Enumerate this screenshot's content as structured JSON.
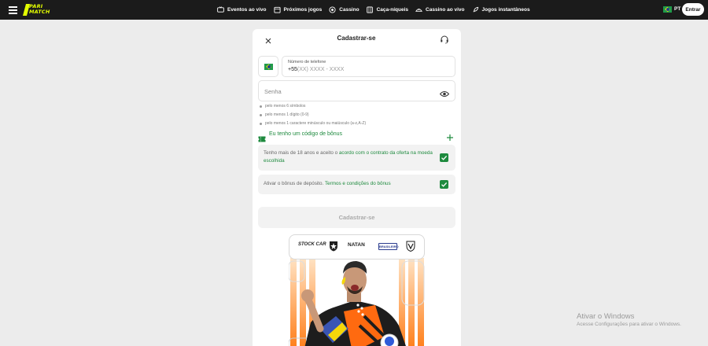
{
  "brand": {
    "logo_line1": "PARI",
    "logo_line2": "MATCH",
    "accent": "#e4ff00"
  },
  "nav": {
    "items": [
      {
        "label": "Eventos ao vivo",
        "icon": "live-tv-icon"
      },
      {
        "label": "Próximos jogos",
        "icon": "calendar-icon"
      },
      {
        "label": "Cassino",
        "icon": "casino-chip-icon"
      },
      {
        "label": "Caça-níqueis",
        "icon": "slot-machine-icon"
      },
      {
        "label": "Cassino ao vivo",
        "icon": "live-casino-icon"
      },
      {
        "label": "Jogos instantâneos",
        "icon": "rocket-icon"
      }
    ],
    "language": "PT",
    "login_label": "Entrar"
  },
  "modal": {
    "title": "Cadastrar-se",
    "phone": {
      "label": "Número de telefone",
      "prefix": "+55",
      "placeholder": "(XX) XXXX - XXXX"
    },
    "password": {
      "placeholder": "Senha"
    },
    "rules": [
      "pelo menos 6 símbolos",
      "pelo menos 1 dígito (0-9)",
      "pelo menos 1 caractere minúsculo ou maiúsculo (a-z,A-Z)"
    ],
    "bonus_code_label": "Eu tenho um código de bônus",
    "consent_age": {
      "text": "Tenho mais de 18 anos e aceito o ",
      "link": "acordo com o contrato da oferta na moeda escolhida",
      "checked": true
    },
    "consent_bonus": {
      "text": "Ativar o bônus de depósito. ",
      "link": "Termos e condições do bônus",
      "checked": true
    },
    "submit_label": "Cadastrar-se",
    "accent": "#1e8a3e"
  },
  "promo": {
    "sponsors": [
      "STOCK CAR",
      "NATAN"
    ],
    "badge": "BRASILEIRO"
  },
  "watermark": {
    "line1": "Ativar o Windows",
    "line2": "Acesse Configurações para ativar o Windows."
  }
}
